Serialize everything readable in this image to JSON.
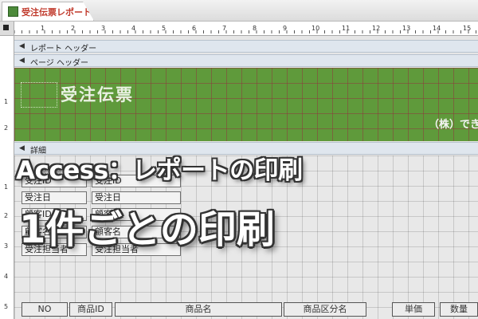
{
  "tab": {
    "title": "受注伝票レポート",
    "icon": "report-icon"
  },
  "ruler": {
    "h_numbers": [
      "1",
      "2",
      "3",
      "4",
      "5",
      "6",
      "7",
      "8",
      "9",
      "10",
      "11",
      "12",
      "13",
      "14",
      "15"
    ],
    "v_numbers": [
      "1",
      "2",
      "1",
      "2",
      "3",
      "4",
      "5"
    ]
  },
  "bands": {
    "report_header": "レポート ヘッダー",
    "page_header": "ページ ヘッダー",
    "detail": "詳細"
  },
  "green": {
    "title": "受注伝票",
    "company": "（株）でき"
  },
  "fields": [
    {
      "label": "受注ID",
      "value": "受注ID"
    },
    {
      "label": "受注日",
      "value": "受注日"
    },
    {
      "label": "顧客ID",
      "value": "顧客ID"
    },
    {
      "label": "顧客名",
      "value": "顧客名"
    },
    {
      "label": "受注担当者",
      "value": "受注担当者"
    }
  ],
  "columns": [
    "NO",
    "商品ID",
    "商品名",
    "商品区分名",
    "単価",
    "数量"
  ],
  "overlay": {
    "line1": "Access：レポートの印刷",
    "line2": "1件ごとの印刷"
  },
  "colors": {
    "green_band": "#5f9a3b",
    "tab_text": "#c0392b"
  }
}
